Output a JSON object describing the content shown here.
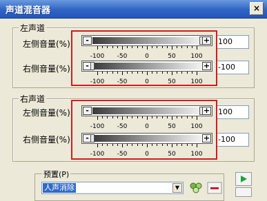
{
  "window": {
    "title": "声道混音器",
    "close_label": "×"
  },
  "groups": [
    {
      "label": "左声道",
      "rows": [
        {
          "label": "左侧音量(%):",
          "value": "100",
          "level_percent": 100
        },
        {
          "label": "右侧音量(%):",
          "value": "-100",
          "level_percent": -100
        }
      ]
    },
    {
      "label": "右声道",
      "rows": [
        {
          "label": "左侧音量(%)",
          "value": "100",
          "level_percent": 100
        },
        {
          "label": "右侧音量(%):",
          "value": "-100",
          "level_percent": -100
        }
      ]
    }
  ],
  "slider": {
    "min_label": "-",
    "max_label": "+",
    "tick_labels": [
      "-100",
      "-50",
      "0",
      "50",
      "100"
    ]
  },
  "preset": {
    "label": "预置(P)",
    "selected": "人声消除"
  },
  "colors": {
    "highlight_red": "#d51a1a",
    "play_green": "#1aa43a"
  }
}
